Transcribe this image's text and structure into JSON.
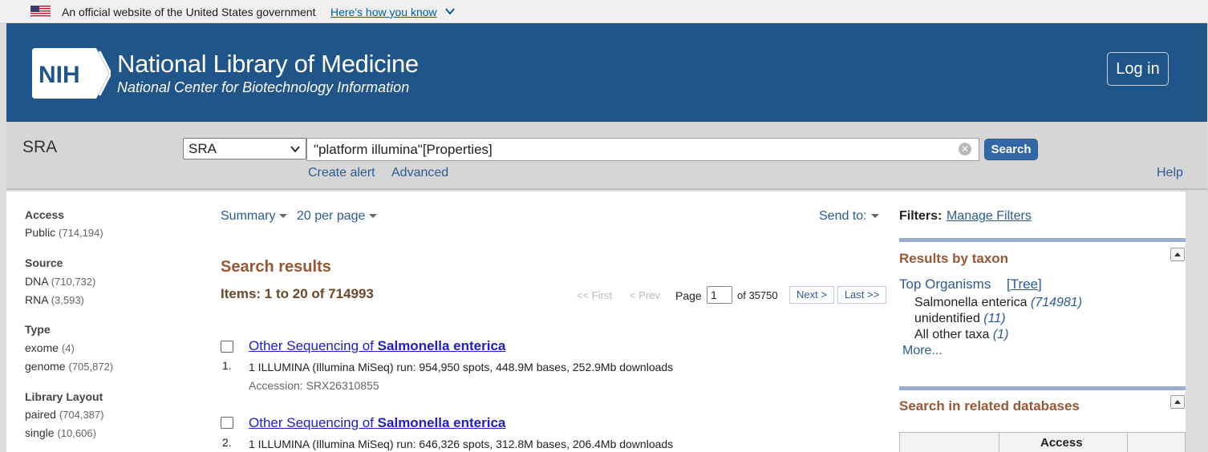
{
  "gov_banner": {
    "text": "An official website of the United States government",
    "link": "Here's how you know"
  },
  "header": {
    "logo_text": "NIH",
    "title": "National Library of Medicine",
    "subtitle": "National Center for Biotechnology Information",
    "login": "Log in"
  },
  "search": {
    "db_title": "SRA",
    "db_selected": "SRA",
    "query": "\"platform illumina\"[Properties]",
    "button": "Search",
    "create_alert": "Create alert",
    "advanced": "Advanced",
    "help": "Help"
  },
  "facets": [
    {
      "title": "Access",
      "items": [
        {
          "label": "Public",
          "count": "(714,194)"
        }
      ]
    },
    {
      "title": "Source",
      "items": [
        {
          "label": "DNA",
          "count": "(710,732)"
        },
        {
          "label": "RNA",
          "count": "(3,593)"
        }
      ]
    },
    {
      "title": "Type",
      "items": [
        {
          "label": "exome",
          "count": "(4)"
        },
        {
          "label": "genome",
          "count": "(705,872)"
        }
      ]
    },
    {
      "title": "Library Layout",
      "items": [
        {
          "label": "paired",
          "count": "(704,387)"
        },
        {
          "label": "single",
          "count": "(10,606)"
        }
      ]
    }
  ],
  "view": {
    "format": "Summary",
    "per_page": "20 per page",
    "send_to": "Send to:"
  },
  "results": {
    "heading": "Search results",
    "items_count": "Items: 1 to 20 of 714993",
    "pager": {
      "first": "<< First",
      "prev": "< Prev",
      "page_label": "Page",
      "page_value": "1",
      "of_total": "of 35750",
      "next": "Next >",
      "last": "Last >>"
    },
    "list": [
      {
        "num": "1.",
        "title_prefix": "Other Sequencing of ",
        "title_bold": "Salmonella enterica",
        "desc": "1 ILLUMINA (Illumina MiSeq) run: 954,950 spots, 448.9M bases, 252.9Mb downloads",
        "accession": "Accession: SRX26310855"
      },
      {
        "num": "2.",
        "title_prefix": "Other Sequencing of ",
        "title_bold": "Salmonella enterica",
        "desc": "1 ILLUMINA (Illumina MiSeq) run: 646,326 spots, 312.8M bases, 206.4Mb downloads"
      }
    ]
  },
  "sidebar": {
    "filters_label": "Filters:",
    "manage_filters": "Manage Filters",
    "taxon_title": "Results by taxon",
    "top_organisms": "Top Organisms",
    "tree": "[Tree]",
    "taxa": [
      {
        "label": "Salmonella enterica",
        "count": "(714981)"
      },
      {
        "label": "unidentified",
        "count": "(11)"
      },
      {
        "label": "All other taxa",
        "count": "(1)"
      }
    ],
    "more": "More...",
    "related_title": "Search in related databases",
    "related_head_access": "Access"
  },
  "colors": {
    "header_bg": "#20558a",
    "search_btn": "#3167a6",
    "heading_brown": "#985735",
    "link_blue": "#2c5b93"
  }
}
